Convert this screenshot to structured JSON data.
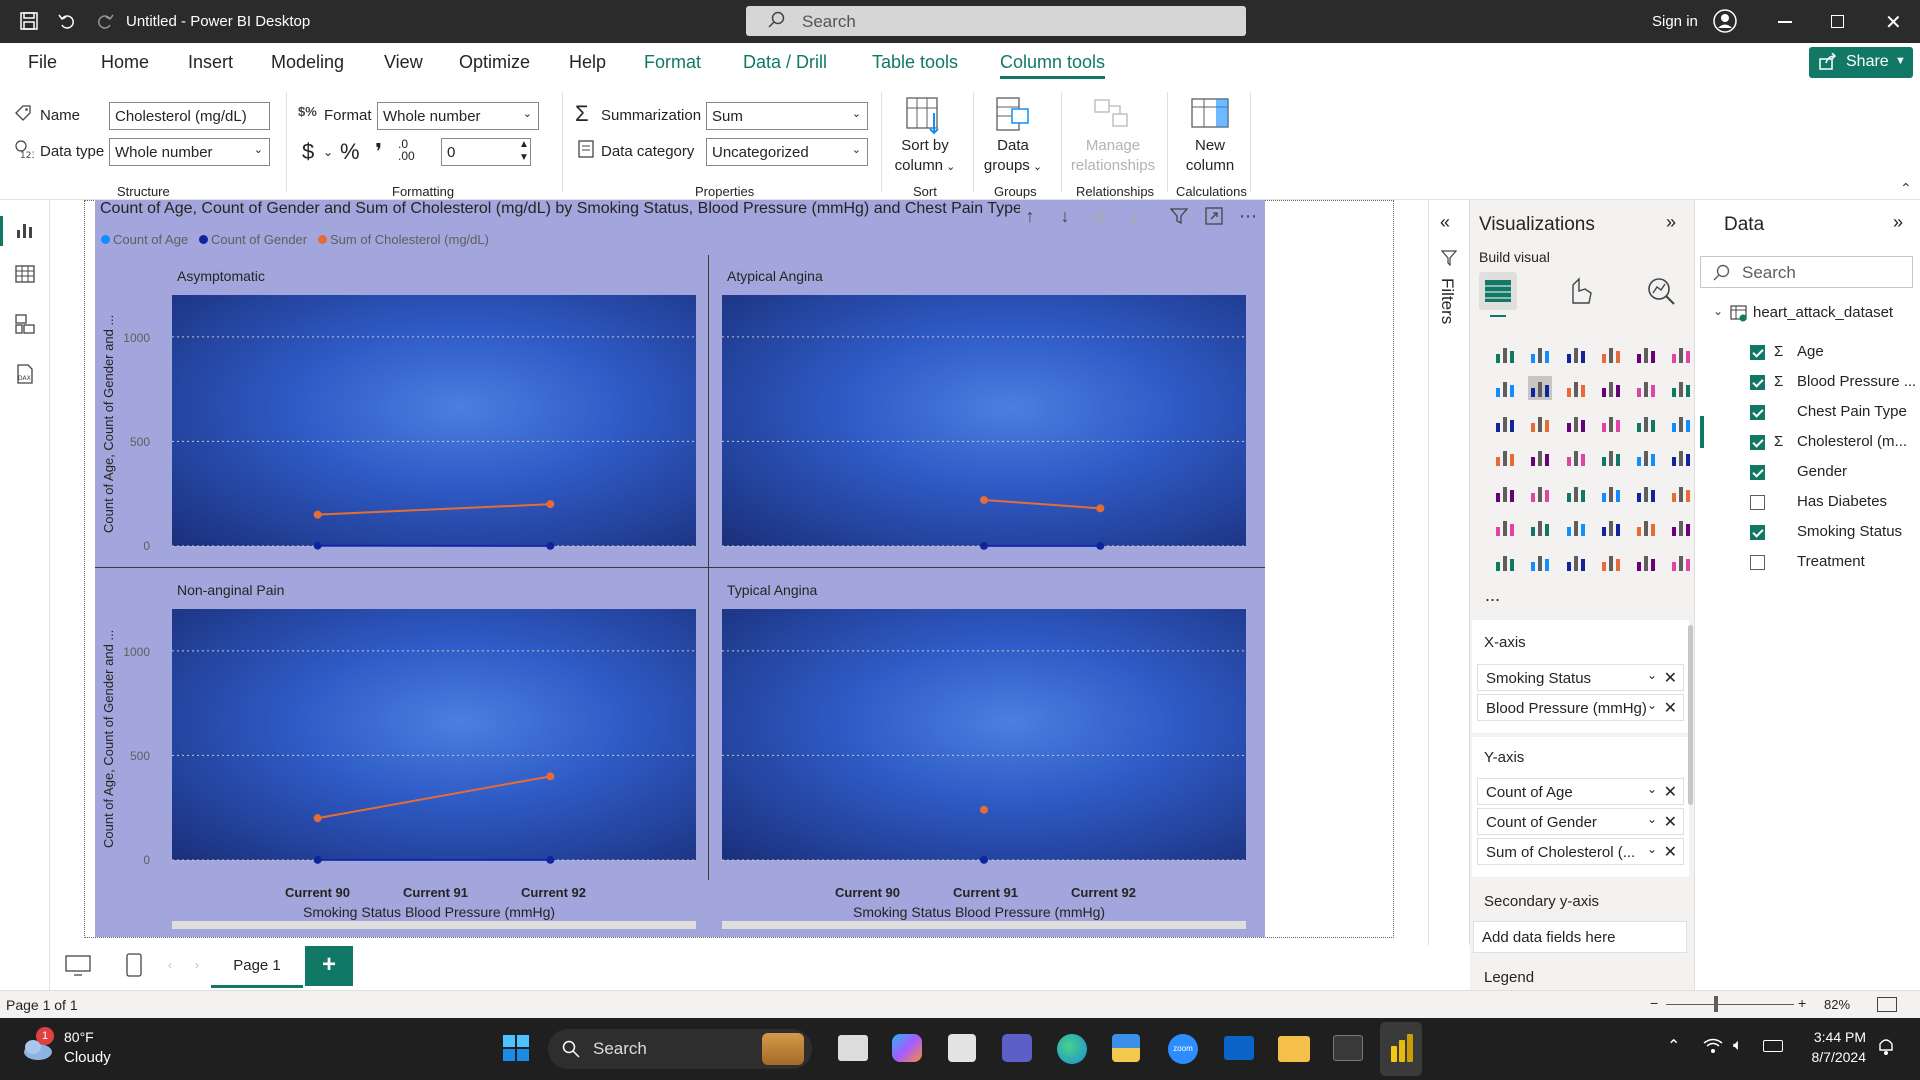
{
  "app": {
    "title": "Untitled - Power BI Desktop",
    "search_placeholder": "Search",
    "sign_in": "Sign in"
  },
  "menu": {
    "items": [
      "File",
      "Home",
      "Insert",
      "Modeling",
      "View",
      "Optimize",
      "Help"
    ],
    "context_items": [
      "Format",
      "Data / Drill",
      "Table tools",
      "Column tools"
    ],
    "active": "Column tools",
    "share": "Share"
  },
  "ribbon": {
    "name_label": "Name",
    "name_value": "Cholesterol (mg/dL)",
    "datatype_label": "Data type",
    "datatype_value": "Whole number",
    "structure_group": "Structure",
    "format_label": "Format",
    "format_value": "Whole number",
    "decimal_value": "0",
    "formatting_group": "Formatting",
    "summarization_label": "Summarization",
    "summarization_value": "Sum",
    "datacategory_label": "Data category",
    "datacategory_value": "Uncategorized",
    "properties_group": "Properties",
    "sort_btn_1": "Sort by",
    "sort_btn_2": "column",
    "sort_group": "Sort",
    "groups_btn_1": "Data",
    "groups_btn_2": "groups",
    "groups_group": "Groups",
    "relationships_btn_1": "Manage",
    "relationships_btn_2": "relationships",
    "relationships_group": "Relationships",
    "newcol_btn_1": "New",
    "newcol_btn_2": "column",
    "calculations_group": "Calculations"
  },
  "visual": {
    "title": "Count of Age, Count of Gender and Sum of Cholesterol (mg/dL) by Smoking Status, Blood Pressure (mmHg) and Chest Pain Type",
    "legend": [
      {
        "label": "Count of Age",
        "color": "#118dff"
      },
      {
        "label": "Count of Gender",
        "color": "#12239e"
      },
      {
        "label": "Sum of Cholesterol (mg/dL)",
        "color": "#e66c37"
      }
    ],
    "y_axis_label": "Count of Age, Count of Gender and ...",
    "y_ticks": [
      "1000",
      "500",
      "0"
    ],
    "x_ticks": [
      "Current 90",
      "Current 91",
      "Current 92"
    ],
    "x_axis_label": "Smoking Status Blood Pressure (mmHg)"
  },
  "chart_data": {
    "type": "line",
    "panels": [
      "Asymptomatic",
      "Atypical Angina",
      "Non-anginal Pain",
      "Typical Angina"
    ],
    "categories": [
      "Current 90",
      "Current 91",
      "Current 92"
    ],
    "ylim": [
      0,
      1200
    ],
    "series": [
      {
        "name": "Count of Age",
        "panel_values": [
          [
            2,
            null,
            1
          ],
          [
            null,
            1,
            1
          ],
          [
            1,
            null,
            1
          ],
          [
            null,
            1,
            null
          ]
        ]
      },
      {
        "name": "Count of Gender",
        "panel_values": [
          [
            2,
            null,
            1
          ],
          [
            null,
            1,
            1
          ],
          [
            1,
            null,
            1
          ],
          [
            null,
            1,
            null
          ]
        ]
      },
      {
        "name": "Sum of Cholesterol (mg/dL)",
        "panel_values": [
          [
            150,
            null,
            200
          ],
          [
            null,
            220,
            180
          ],
          [
            200,
            null,
            400
          ],
          [
            null,
            240,
            null
          ]
        ]
      }
    ]
  },
  "filters": {
    "label": "Filters"
  },
  "visualizations": {
    "title": "Visualizations",
    "build_visual": "Build visual",
    "more": "...",
    "x_axis_label": "X-axis",
    "x_axis_fields": [
      "Smoking Status",
      "Blood Pressure (mmHg)"
    ],
    "y_axis_label": "Y-axis",
    "y_axis_fields": [
      "Count of Age",
      "Count of Gender",
      "Sum of Cholesterol (..."
    ],
    "secondary_label": "Secondary y-axis",
    "secondary_placeholder": "Add data fields here",
    "legend_label": "Legend"
  },
  "data_pane": {
    "title": "Data",
    "search_placeholder": "Search",
    "table_name": "heart_attack_dataset",
    "fields": [
      {
        "name": "Age",
        "checked": true,
        "sigma": true
      },
      {
        "name": "Blood Pressure ...",
        "checked": true,
        "sigma": true
      },
      {
        "name": "Chest Pain Type",
        "checked": true,
        "sigma": false
      },
      {
        "name": "Cholesterol (m...",
        "checked": true,
        "sigma": true
      },
      {
        "name": "Gender",
        "checked": true,
        "sigma": false
      },
      {
        "name": "Has Diabetes",
        "checked": false,
        "sigma": false
      },
      {
        "name": "Smoking Status",
        "checked": true,
        "sigma": false
      },
      {
        "name": "Treatment",
        "checked": false,
        "sigma": false
      }
    ]
  },
  "pages": {
    "tab": "Page 1",
    "add": "+"
  },
  "status": {
    "page_info": "Page 1 of 1",
    "zoom": "82%"
  },
  "taskbar": {
    "weather_temp": "80°F",
    "weather_desc": "Cloudy",
    "weather_badge": "1",
    "search": "Search",
    "time": "3:44 PM",
    "date": "8/7/2024"
  }
}
